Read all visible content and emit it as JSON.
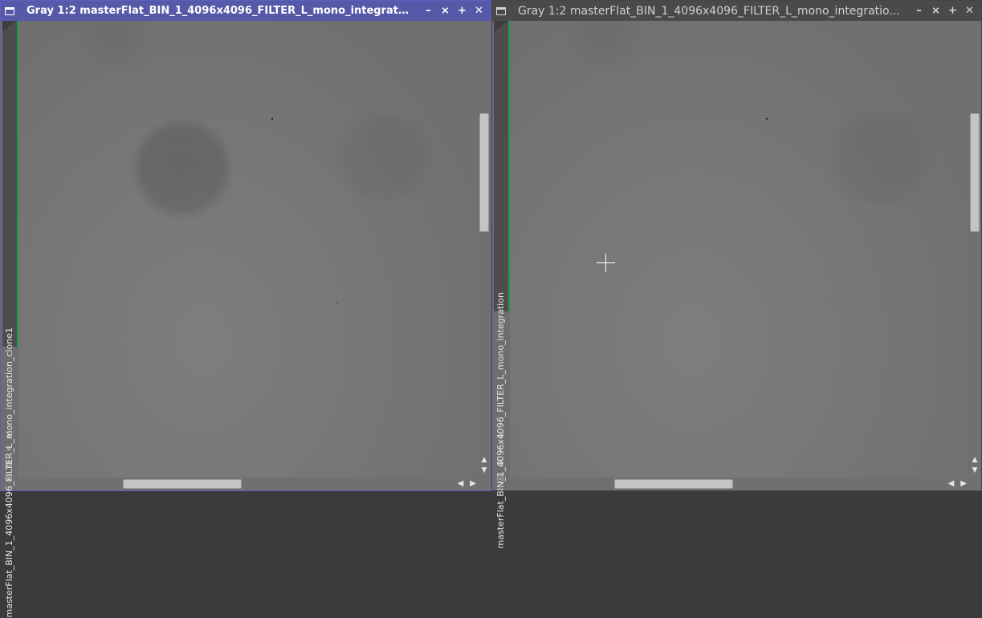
{
  "windows": {
    "left": {
      "title": "Gray 1:2 masterFlat_BIN_1_4096x4096_FILTER_L_mono_integratio...",
      "tab_label": "masterFlat_BIN_1_4096x4096_FILTER_L_mono_integration_clone1",
      "active": true
    },
    "right": {
      "title": "Gray 1:2 masterFlat_BIN_1_4096x4096_FILTER_L_mono_integratio...",
      "tab_label": "masterFlat_BIN_1_4096x4096_FILTER_L_mono_integration",
      "active": false
    }
  },
  "icons": {
    "system_menu": "window-icon",
    "minimize": "minimize-icon",
    "shade": "shade-icon",
    "maximize": "maximize-icon",
    "close": "close-icon",
    "side": [
      "shrink-icon",
      "fit-view-icon",
      "clone-icon",
      "target-icon"
    ],
    "cursor": "crosshair-icon"
  },
  "colors": {
    "active_titlebar": "#5658a8",
    "inactive_titlebar": "#4a4a4a",
    "tab_accent": "#1f9c4a"
  }
}
